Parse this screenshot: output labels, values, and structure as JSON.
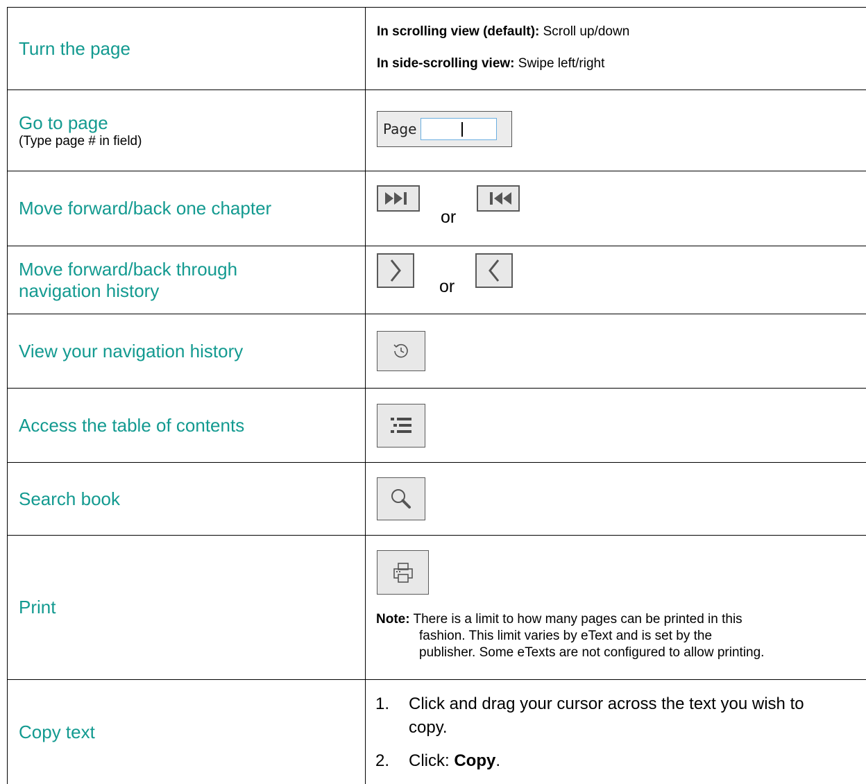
{
  "rows": {
    "turn": {
      "action": "Turn the page",
      "scroll_bold": "In scrolling view (default):",
      "scroll_text": " Scroll up/down",
      "side_bold": "In side-scrolling view:",
      "side_text": " Swipe left/right"
    },
    "goto": {
      "action": "Go to page",
      "sub": "(Type page # in field)",
      "field_label": "Page",
      "field_value": ""
    },
    "chapter": {
      "action": "Move forward/back one chapter",
      "or": "or",
      "forward_icon": "skip-forward-icon",
      "back_icon": "skip-back-icon"
    },
    "history_nav": {
      "action_line1": "Move forward/back through",
      "action_line2": "navigation history",
      "or": "or",
      "forward_icon": "chevron-right-icon",
      "back_icon": "chevron-left-icon"
    },
    "view_history": {
      "action": "View your navigation history",
      "icon": "history-icon"
    },
    "toc": {
      "action": "Access the table of contents",
      "icon": "list-icon"
    },
    "search": {
      "action": "Search book",
      "icon": "search-icon"
    },
    "print": {
      "action": "Print",
      "icon": "printer-icon",
      "note_label": "Note:",
      "note_line1": " There is a limit to how many pages can be printed in this",
      "note_line2": "fashion. This limit varies by eText and is set by the",
      "note_line3": "publisher. Some eTexts are not configured to allow printing."
    },
    "copy": {
      "action": "Copy text",
      "step1_num": "1.",
      "step1_line1": "Click and drag your cursor across the text you wish to",
      "step1_line2": "copy.",
      "step2_num": "2.",
      "step2_text": "Click: ",
      "step2_bold": "Copy",
      "step2_end": "."
    }
  },
  "colors": {
    "action_text": "#139a90",
    "border": "#000000",
    "button_bg": "#e8e8e8"
  }
}
